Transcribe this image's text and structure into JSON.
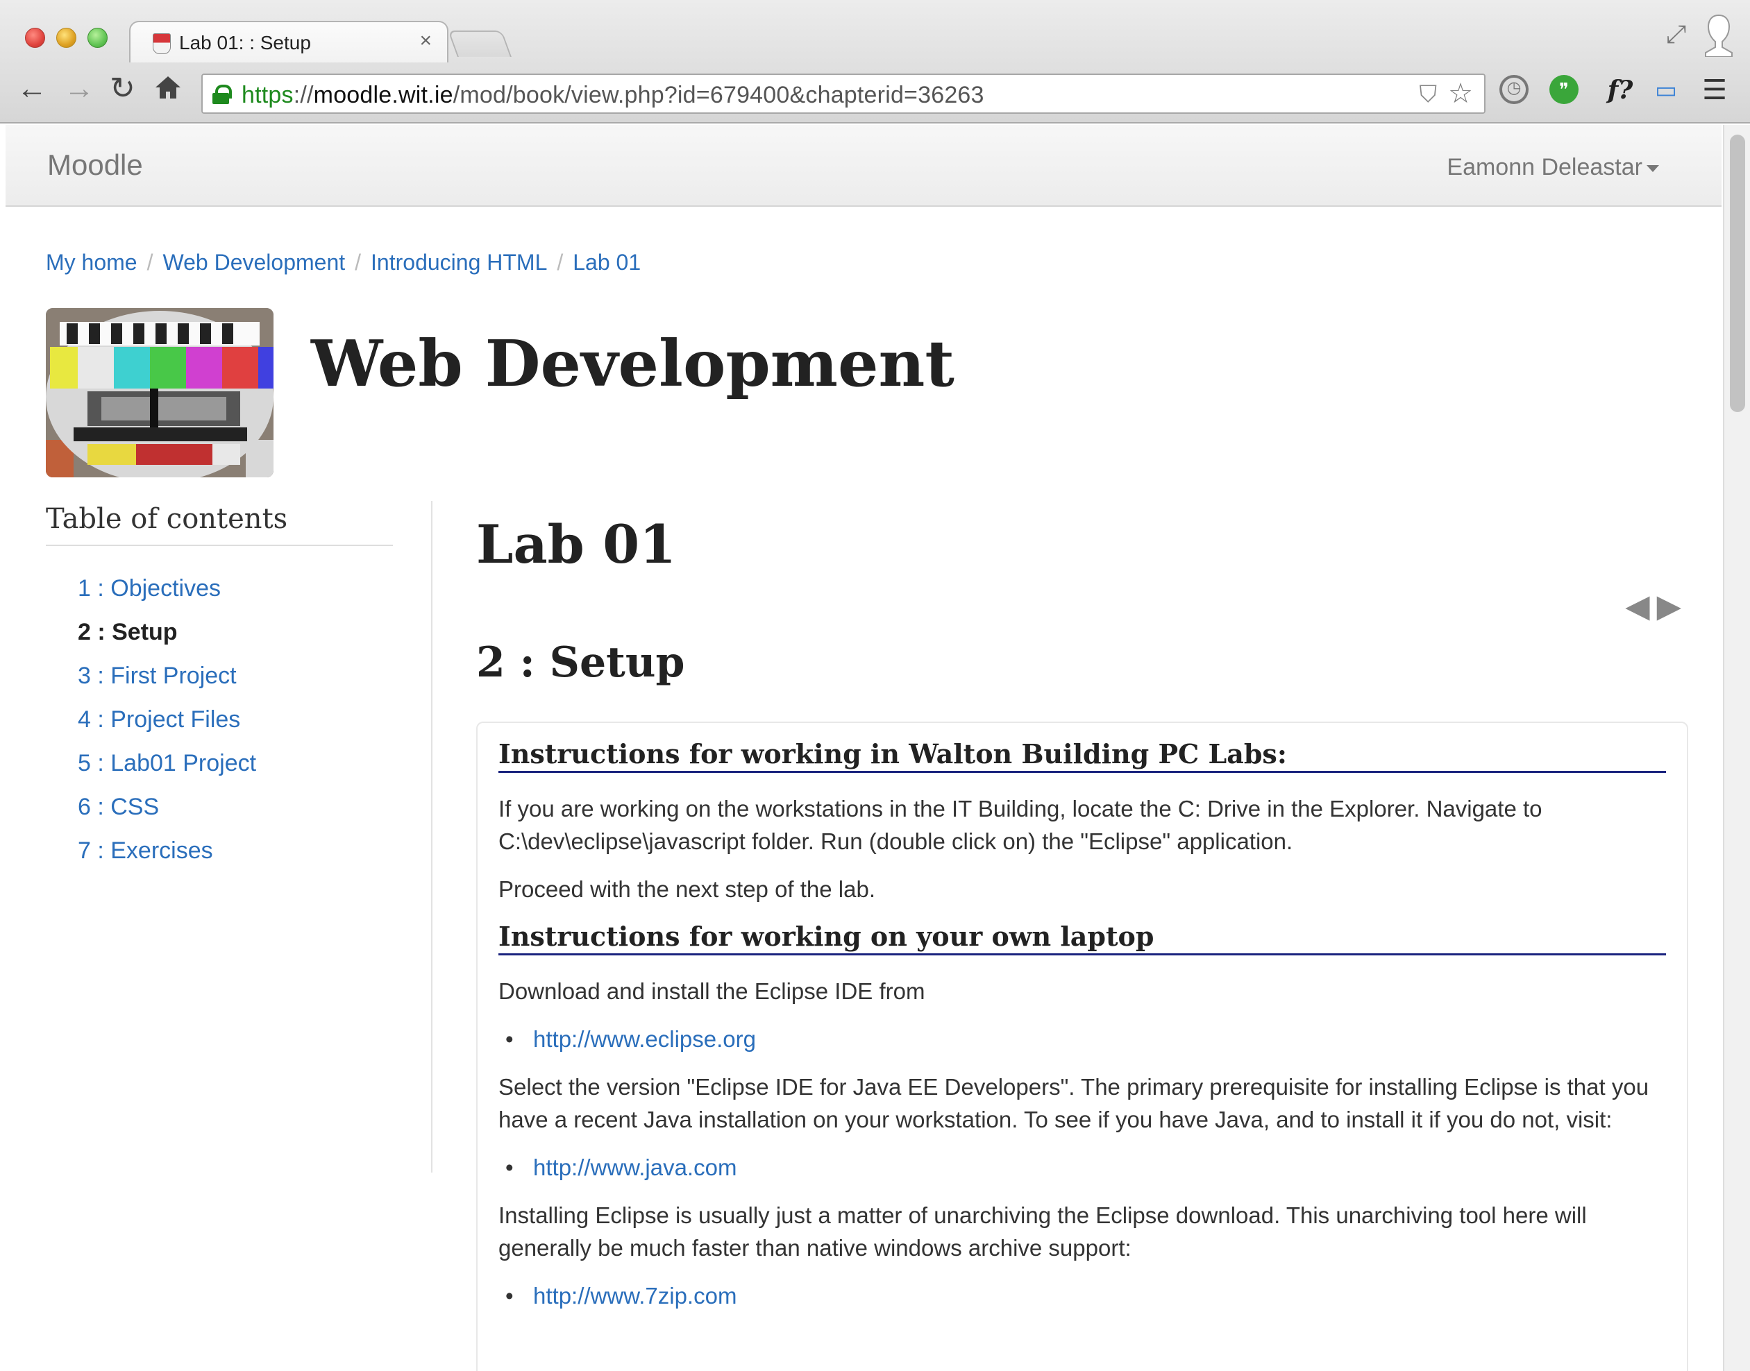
{
  "browser": {
    "tab_title": "Lab 01: : Setup",
    "tab_close": "×",
    "url_scheme": "https",
    "url_sep": "://",
    "url_host": "moodle.wit.ie",
    "url_path": "/mod/book/view.php?id=679400&chapterid=36263",
    "ext_font_label": "f?"
  },
  "navbar": {
    "brand": "Moodle",
    "user_name": "Eamonn Deleastar"
  },
  "breadcrumb": [
    "My home",
    "Web Development",
    "Introducing HTML",
    "Lab 01"
  ],
  "breadcrumb_sep": "/",
  "course": {
    "title": "Web Development"
  },
  "toc": {
    "title": "Table of contents",
    "items": [
      "1 : Objectives",
      "2 : Setup",
      "3 : First Project",
      "4 : Project Files",
      "5 : Lab01 Project",
      "6 : CSS",
      "7 : Exercises"
    ],
    "current_index": 1
  },
  "main": {
    "chapter_title": "Lab 01",
    "prev_arrow": "◀",
    "next_arrow": "▶",
    "subchapter_title": "2 : Setup",
    "sections": {
      "lab_heading": "Instructions for working in Walton Building PC Labs:",
      "lab_para1": "If you are working on the workstations in the IT Building, locate the C: Drive in the Explorer. Navigate to C:\\dev\\eclipse\\javascript folder. Run (double click on) the \"Eclipse\" application.",
      "lab_para2": "Proceed with the next step of the lab.",
      "laptop_heading": "Instructions for working on your own laptop",
      "laptop_para1": "Download and install the Eclipse IDE from",
      "link_eclipse": "http://www.eclipse.org",
      "laptop_para2": "Select the version \"Eclipse IDE for Java EE Developers\". The primary prerequisite for installing Eclipse is that you have a recent Java installation on your workstation. To see if you have Java, and to install it if you do not, visit:",
      "link_java": "http://www.java.com",
      "laptop_para3": "Installing Eclipse is usually just a matter of unarchiving the Eclipse download. This unarchiving tool here will generally be much faster than native windows archive support:",
      "link_7zip": "http://www.7zip.com"
    }
  },
  "colors": {
    "link": "#2a6ebb",
    "heading_rule": "#1a237e",
    "secure_green": "#1e8a1e"
  }
}
